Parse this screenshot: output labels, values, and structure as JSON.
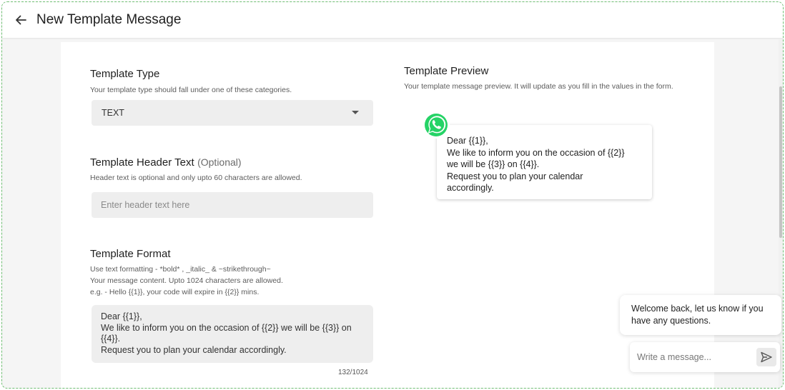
{
  "header": {
    "title": "New Template Message"
  },
  "template_type": {
    "title": "Template Type",
    "helper": "Your template type should fall under one of these categories.",
    "selected": "TEXT"
  },
  "header_text": {
    "title": "Template Header Text",
    "optional": "(Optional)",
    "helper": "Header text is optional and only upto 60 characters are allowed.",
    "placeholder": "Enter header text here",
    "value": ""
  },
  "template_format": {
    "title": "Template Format",
    "helper_1": "Use text formatting - *bold* , _italic_ & ~strikethrough~",
    "helper_2": "Your message content. Upto 1024 characters are allowed.",
    "helper_3": "e.g. - Hello {{1}}, your code will expire in {{2}} mins.",
    "value": "Dear {{1}},\nWe like to inform you on the occasion of {{2}} we will be {{3}} on {{4}}.\nRequest you to plan your calendar accordingly.",
    "counter": "132/1024"
  },
  "preview": {
    "title": "Template Preview",
    "helper": "Your template message preview. It will update as you fill in the values in the form.",
    "message": "Dear {{1}},\nWe like to inform you on the occasion of {{2}}\nwe will be {{3}} on {{4}}.\nRequest you to plan your calendar\naccordingly."
  },
  "chat_widget": {
    "message": "Welcome back, let us know if you have any questions.",
    "placeholder": "Write a message..."
  },
  "colors": {
    "whatsapp_green": "#25D366",
    "field_background": "#eeeeee",
    "frame_border": "#6fbf73"
  },
  "icons": {
    "back": "arrow-left-icon",
    "dropdown": "caret-down-icon",
    "whatsapp": "whatsapp-icon",
    "send": "send-icon"
  }
}
